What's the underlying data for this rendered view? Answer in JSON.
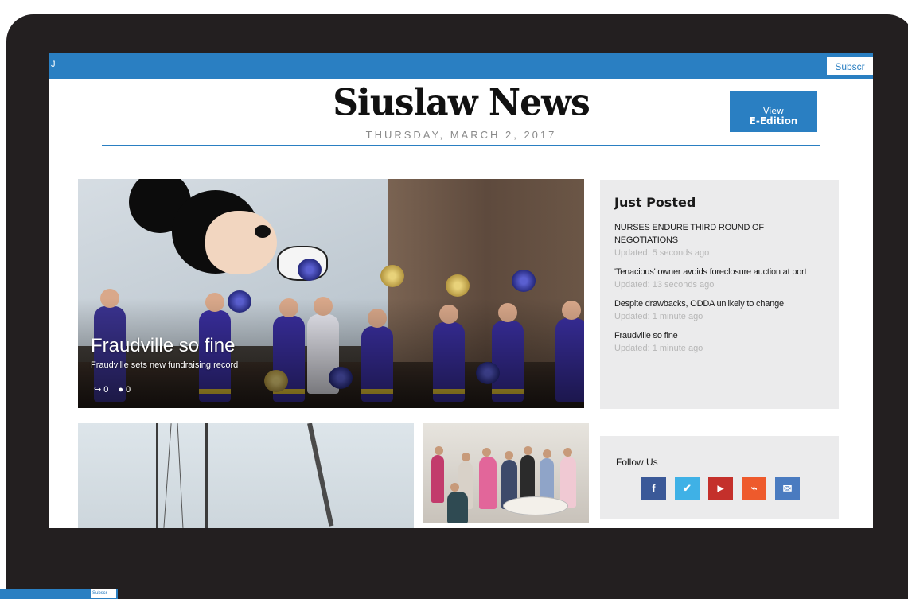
{
  "topbar": {
    "edge_char": "J",
    "subscribe_label": "Subscr"
  },
  "masthead": {
    "logo": "Siuslaw News",
    "date": "THURSDAY, MARCH 2, 2017",
    "eedition_line1": "View",
    "eedition_line2": "E-Edition"
  },
  "hero": {
    "title": "Fraudville so fine",
    "subtitle": "Fraudville sets new fundraising record",
    "shares": "0",
    "comments": "0"
  },
  "just_posted": {
    "title": "Just Posted",
    "items": [
      {
        "headline": "NURSES ENDURE THIRD ROUND OF NEGOTIATIONS",
        "updated": "Updated: 5 seconds ago"
      },
      {
        "headline": "'Tenacious' owner avoids foreclosure auction at port",
        "updated": "Updated: 13 seconds ago"
      },
      {
        "headline": "Despite drawbacks, ODDA unlikely to change",
        "updated": "Updated: 1 minute ago"
      },
      {
        "headline": "Fraudville so fine",
        "updated": "Updated: 1 minute ago"
      }
    ]
  },
  "follow": {
    "title": "Follow Us",
    "icons": [
      {
        "name": "facebook-icon",
        "glyph": "f",
        "color": "#3b5998"
      },
      {
        "name": "twitter-icon",
        "glyph": "🐦",
        "color": "#3fb1e6"
      },
      {
        "name": "youtube-icon",
        "glyph": "▶",
        "color": "#c4302b"
      },
      {
        "name": "rss-icon",
        "glyph": "⌁",
        "color": "#ee5a2c"
      },
      {
        "name": "email-icon",
        "glyph": "✉",
        "color": "#4a7bc0"
      }
    ]
  },
  "ghost": {
    "subscribe_label": "Subscr"
  },
  "colors": {
    "accent": "#2a7fc2",
    "bezel": "#231f20",
    "sidebar_bg": "#ebebec"
  }
}
